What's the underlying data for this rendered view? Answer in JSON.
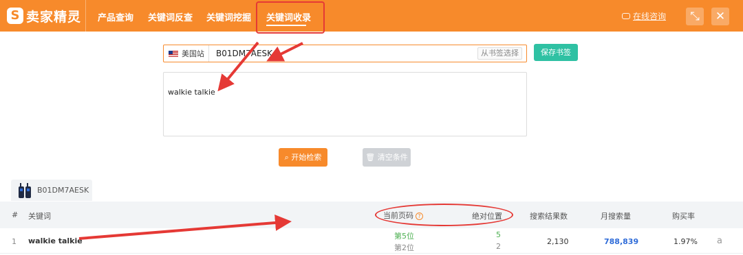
{
  "app": {
    "logo_mark": "S",
    "logo_text": "卖家精灵"
  },
  "nav": {
    "items": [
      {
        "label": "产品查询"
      },
      {
        "label": "关键词反查"
      },
      {
        "label": "关键词挖掘"
      },
      {
        "label": "关键词收录"
      }
    ],
    "active_index": 3
  },
  "header_right": {
    "consult_label": "在线咨询",
    "shrink_icon": "⤡",
    "close_icon": "✕"
  },
  "search": {
    "site_label": "美国站",
    "asin_value": "B01DM7AESK",
    "bookmark_label": "从书签选择",
    "save_label": "保存书签"
  },
  "keywords": {
    "text": "walkie talkie"
  },
  "actions": {
    "start_label": "开始检索",
    "clear_label": "清空条件"
  },
  "asin_tab": {
    "label": "B01DM7AESK"
  },
  "table": {
    "headers": {
      "index": "#",
      "keyword": "关键词",
      "current_page": "当前页码",
      "help": "?",
      "abs_position": "绝对位置",
      "search_results": "搜索结果数",
      "monthly_search": "月搜索量",
      "purchase_rate": "购买率"
    },
    "rows": [
      {
        "index": "1",
        "keyword": "walkie talkie",
        "page_primary": "第5位",
        "page_secondary": "第2位",
        "pos_primary": "5",
        "pos_secondary": "2",
        "search_results": "2,130",
        "monthly_search": "788,839",
        "purchase_rate": "1.97%",
        "amazon_icon": "a"
      }
    ]
  },
  "colors": {
    "brand": "#f78a2b",
    "save": "#2fc1a3",
    "annotation": "#e53935",
    "link": "#2e6bd8",
    "green": "#4caf50"
  }
}
